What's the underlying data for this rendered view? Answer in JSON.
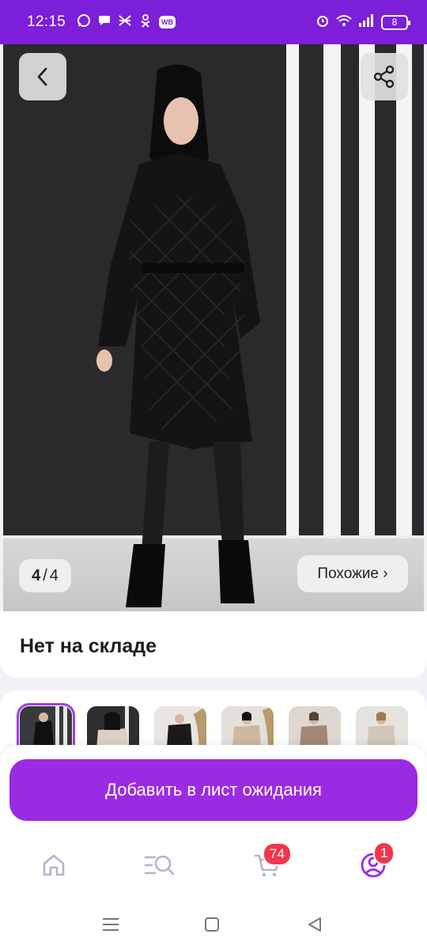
{
  "status_bar": {
    "time": "12:15",
    "notification_icons": [
      "whatsapp-icon",
      "chat-icon",
      "app-icon",
      "ok-icon",
      "wb-icon"
    ],
    "wb_label": "WB",
    "battery_level": "8",
    "accent_color": "#7b1fd8"
  },
  "gallery": {
    "current": "4",
    "separator": "/",
    "total": "4",
    "similar_label": "Похожие ›"
  },
  "product": {
    "stock_status": "Нет на складе"
  },
  "thumbnails": {
    "count": 6,
    "active_index": 0
  },
  "actions": {
    "waitlist_label": "Добавить в лист ожидания",
    "button_color": "#9a2be2"
  },
  "tabbar": {
    "cart_badge": "74",
    "profile_badge": "1",
    "badge_color": "#f0364d",
    "icons": [
      "home-icon",
      "catalog-search-icon",
      "cart-icon",
      "profile-icon"
    ]
  },
  "system_nav": {
    "icons": [
      "menu-icon",
      "home-square-icon",
      "back-triangle-icon"
    ]
  }
}
